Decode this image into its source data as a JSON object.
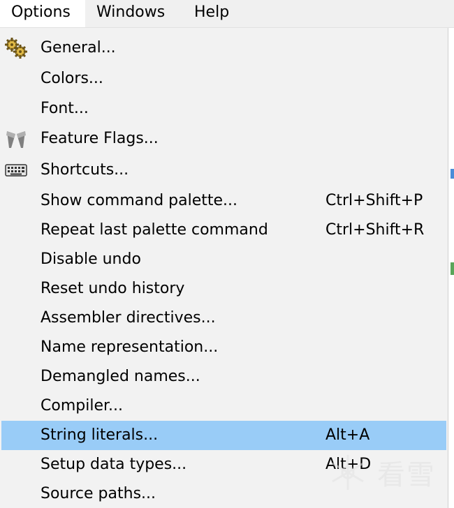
{
  "menubar": {
    "items": [
      "Options",
      "Windows",
      "Help"
    ]
  },
  "menu": {
    "items": [
      {
        "label": "General...",
        "shortcut": "",
        "icon": "gears-icon"
      },
      {
        "label": "Colors...",
        "shortcut": "",
        "icon": ""
      },
      {
        "label": "Font...",
        "shortcut": "",
        "icon": ""
      },
      {
        "label": "Feature Flags...",
        "shortcut": "",
        "icon": "flags-icon"
      },
      {
        "label": "Shortcuts...",
        "shortcut": "",
        "icon": "keyboard-icon"
      },
      {
        "label": "Show command palette...",
        "shortcut": "Ctrl+Shift+P",
        "icon": ""
      },
      {
        "label": "Repeat last palette command",
        "shortcut": "Ctrl+Shift+R",
        "icon": ""
      },
      {
        "label": "Disable undo",
        "shortcut": "",
        "icon": ""
      },
      {
        "label": "Reset undo history",
        "shortcut": "",
        "icon": ""
      },
      {
        "label": "Assembler directives...",
        "shortcut": "",
        "icon": ""
      },
      {
        "label": "Name representation...",
        "shortcut": "",
        "icon": ""
      },
      {
        "label": "Demangled names...",
        "shortcut": "",
        "icon": ""
      },
      {
        "label": "Compiler...",
        "shortcut": "",
        "icon": ""
      },
      {
        "label": "String literals...",
        "shortcut": "Alt+A",
        "icon": "",
        "highlighted": true
      },
      {
        "label": "Setup data types...",
        "shortcut": "Alt+D",
        "icon": ""
      },
      {
        "label": "Source paths...",
        "shortcut": "",
        "icon": ""
      }
    ]
  },
  "watermark": {
    "text": "看雪"
  },
  "colors": {
    "highlight": "#99ccf7",
    "menu_bg": "#f2f2f2",
    "menubar_bg": "#f0f0f0"
  }
}
